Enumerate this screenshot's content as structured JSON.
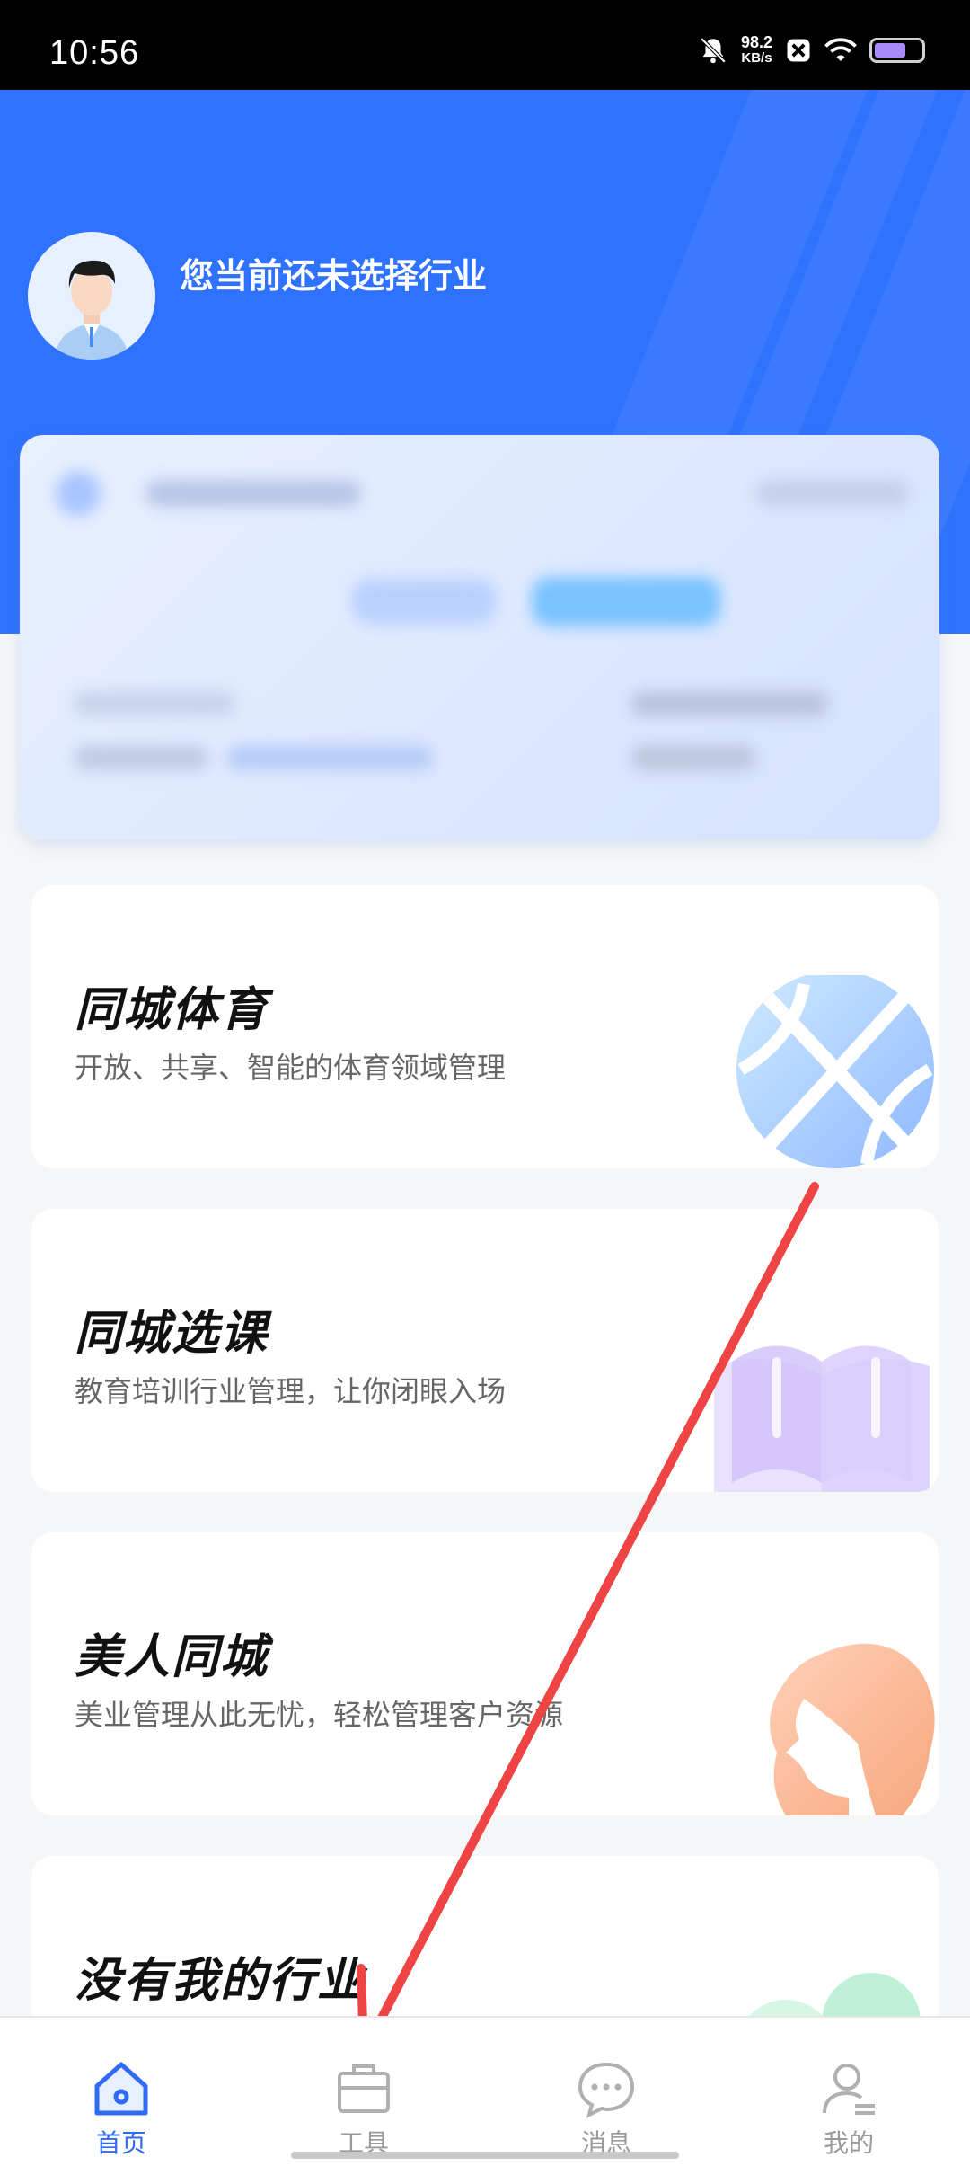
{
  "status_bar": {
    "time": "10:56",
    "net_speed_value": "98.2",
    "net_speed_unit": "KB/s"
  },
  "header": {
    "title": "您当前还未选择行业"
  },
  "industries": [
    {
      "title": "同城体育",
      "subtitle": "开放、共享、智能的体育领域管理",
      "icon": "basketball-icon"
    },
    {
      "title": "同城选课",
      "subtitle": "教育培训行业管理，让你闭眼入场",
      "icon": "book-icon"
    },
    {
      "title": "美人同城",
      "subtitle": "美业管理从此无忧，轻松管理客户资源",
      "icon": "woman-profile-icon"
    },
    {
      "title": "没有我的行业",
      "subtitle": "",
      "icon": "circles-icon"
    }
  ],
  "tabbar": {
    "tabs": [
      {
        "label": "首页",
        "icon": "home-icon",
        "active": true
      },
      {
        "label": "工具",
        "icon": "toolbox-icon",
        "active": false
      },
      {
        "label": "消息",
        "icon": "message-icon",
        "active": false
      },
      {
        "label": "我的",
        "icon": "user-icon",
        "active": false
      }
    ]
  },
  "colors": {
    "primary": "#2f72ff",
    "active_tab": "#2f6bf5",
    "inactive_tab": "#9a9a9a"
  }
}
